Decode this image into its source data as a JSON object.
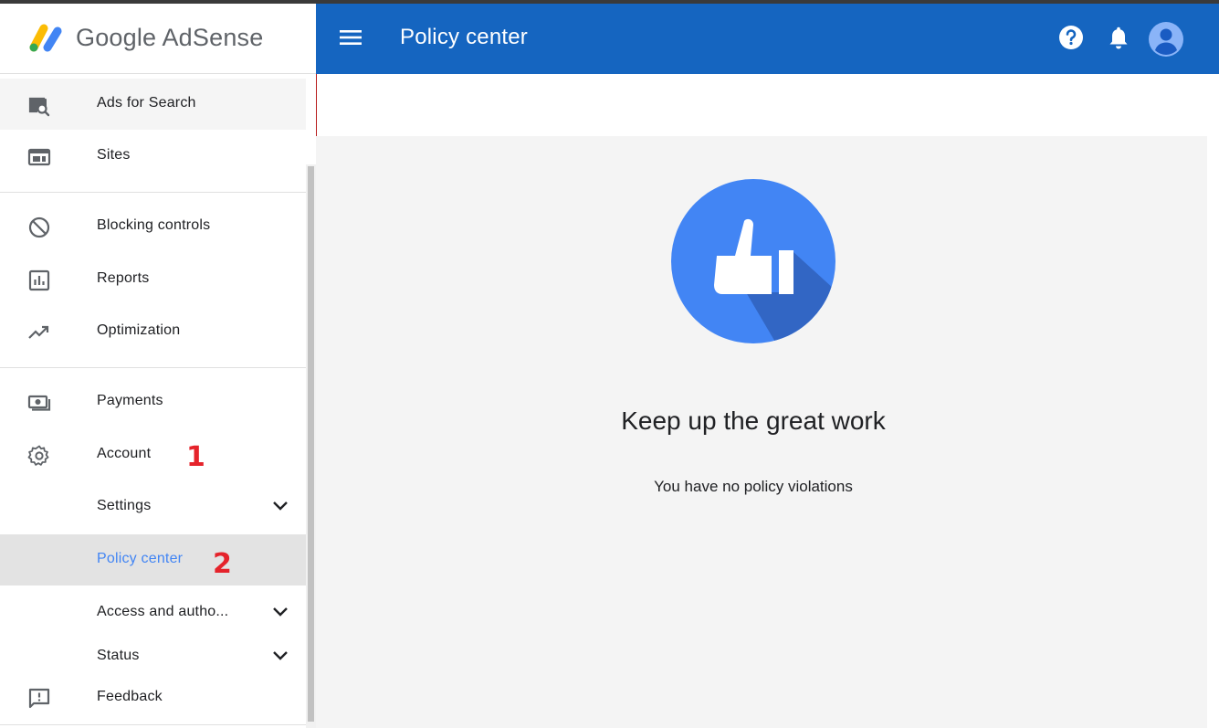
{
  "app": {
    "logo_text": "Google AdSense"
  },
  "header": {
    "title": "Policy center",
    "help_icon": "help-icon",
    "bell_icon": "notifications-icon",
    "avatar_icon": "account-avatar"
  },
  "sidebar": {
    "items": [
      {
        "label": "Ads for Search",
        "icon": "search-ads-icon"
      },
      {
        "label": "Sites",
        "icon": "sites-icon"
      },
      {
        "label": "Blocking controls",
        "icon": "block-icon"
      },
      {
        "label": "Reports",
        "icon": "reports-icon"
      },
      {
        "label": "Optimization",
        "icon": "trending-up-icon"
      },
      {
        "label": "Payments",
        "icon": "payments-icon"
      },
      {
        "label": "Account",
        "icon": "gear-icon"
      },
      {
        "label": "Settings",
        "icon": "chevron-down-icon"
      },
      {
        "label": "Policy center",
        "icon": ""
      },
      {
        "label": "Access and autho...",
        "icon": "chevron-down-icon"
      },
      {
        "label": "Status",
        "icon": "chevron-down-icon"
      },
      {
        "label": "Feedback",
        "icon": "feedback-icon"
      }
    ],
    "annotations": [
      "1",
      "2"
    ]
  },
  "main": {
    "title": "Keep up the great work",
    "subtitle": "You have no policy violations"
  },
  "colors": {
    "header": "#1565c0",
    "accent": "#4285f4",
    "annotation": "#e5232b"
  }
}
